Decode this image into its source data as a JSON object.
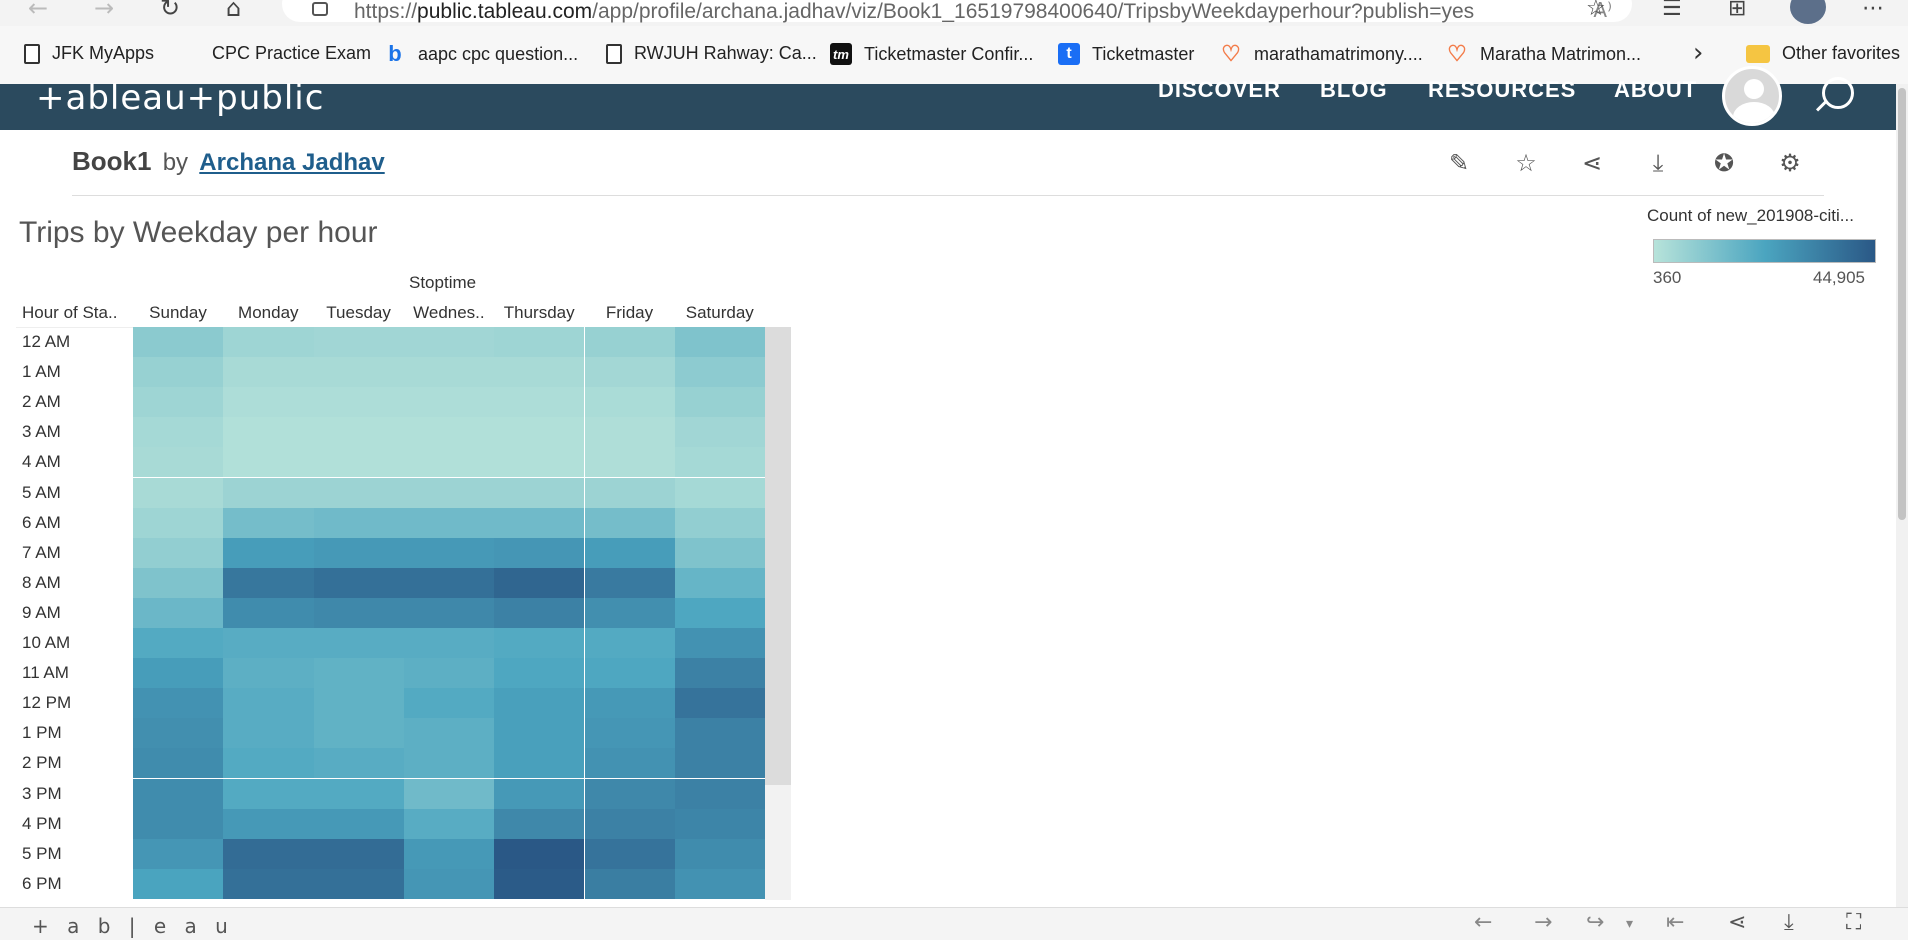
{
  "browser": {
    "url_prefix": "https://",
    "url_host": "public.tableau.com",
    "url_path": "/app/profile/archana.jadhav/viz/Book1_16519798400640/TripsbyWeekdayperhour?publish=yes",
    "read_aloud_label": "A⁾"
  },
  "favorites": [
    {
      "label": "JFK MyApps",
      "icon": "document-icon"
    },
    {
      "label": "CPC Practice Exam",
      "icon": "none"
    },
    {
      "label": "aapc cpc question...",
      "icon": "bing-icon"
    },
    {
      "label": "RWJUH Rahway: Ca...",
      "icon": "document-icon"
    },
    {
      "label": "Ticketmaster Confir...",
      "icon": "tm-icon"
    },
    {
      "label": "Ticketmaster",
      "icon": "t-icon"
    },
    {
      "label": "marathamatrimony....",
      "icon": "heart-icon"
    },
    {
      "label": "Maratha Matrimon...",
      "icon": "heart-icon"
    }
  ],
  "favorites_other": "Other favorites",
  "tableau_nav": {
    "logo": "+ableau+public",
    "items": [
      "DISCOVER",
      "BLOG",
      "RESOURCES",
      "ABOUT"
    ]
  },
  "workbook": {
    "title": "Book1",
    "by": "by",
    "author": "Archana Jadhav"
  },
  "viz": {
    "title": "Trips by Weekday  per hour",
    "column_axis_title": "Stoptime",
    "row_axis_title": "Hour of Sta..",
    "legend": {
      "title": "Count of new_201908-citi...",
      "min_label": "360",
      "max_label": "44,905",
      "colors": [
        "#b7e3da",
        "#4ba5c0",
        "#2a5886"
      ]
    }
  },
  "chart_data": {
    "type": "heatmap",
    "title": "Trips by Weekday  per hour",
    "xlabel": "Stoptime",
    "ylabel": "Hour of Sta..",
    "columns": [
      "Sunday",
      "Monday",
      "Tuesday",
      "Wednes..",
      "Thursday",
      "Friday",
      "Saturday"
    ],
    "rows": [
      "12 AM",
      "1 AM",
      "2 AM",
      "3 AM",
      "4 AM",
      "5 AM",
      "6 AM",
      "7 AM",
      "8 AM",
      "9 AM",
      "10 AM",
      "11 AM",
      "12 PM",
      "1 PM",
      "2 PM",
      "3 PM",
      "4 PM",
      "5 PM",
      "6 PM"
    ],
    "value_range": [
      360,
      44905
    ],
    "values": [
      [
        9500,
        5500,
        5000,
        5000,
        5500,
        7000,
        12000
      ],
      [
        7000,
        3500,
        3500,
        3500,
        3500,
        4500,
        9000
      ],
      [
        5500,
        2500,
        2500,
        2500,
        2500,
        3000,
        7000
      ],
      [
        4000,
        1500,
        1500,
        1500,
        1500,
        2000,
        5000
      ],
      [
        3500,
        1500,
        1500,
        1500,
        1500,
        2000,
        4000
      ],
      [
        3500,
        6000,
        6000,
        6000,
        6000,
        6000,
        4000
      ],
      [
        5500,
        14000,
        15000,
        15000,
        15000,
        14000,
        8000
      ],
      [
        8000,
        25000,
        26000,
        26000,
        27000,
        25000,
        12000
      ],
      [
        12000,
        36000,
        38000,
        38000,
        41000,
        35000,
        17000
      ],
      [
        16000,
        30000,
        31000,
        31000,
        33000,
        29000,
        22000
      ],
      [
        21000,
        20000,
        20000,
        20000,
        21000,
        21000,
        28000
      ],
      [
        25000,
        19000,
        18000,
        19000,
        22000,
        22000,
        33000
      ],
      [
        28000,
        20000,
        18000,
        21000,
        24000,
        26000,
        37000
      ],
      [
        29000,
        20000,
        18000,
        19000,
        24000,
        27000,
        33000
      ],
      [
        30000,
        21000,
        20000,
        19000,
        24000,
        28000,
        33000
      ],
      [
        30000,
        21000,
        21000,
        15000,
        26000,
        31000,
        33000
      ],
      [
        30000,
        26000,
        26000,
        20000,
        31000,
        33000,
        32000
      ],
      [
        27000,
        39000,
        39000,
        26000,
        44905,
        37000,
        30000
      ],
      [
        23000,
        38000,
        38000,
        27000,
        44000,
        34000,
        28000
      ]
    ]
  },
  "footer": {
    "logo": "+ a b | e a u"
  }
}
